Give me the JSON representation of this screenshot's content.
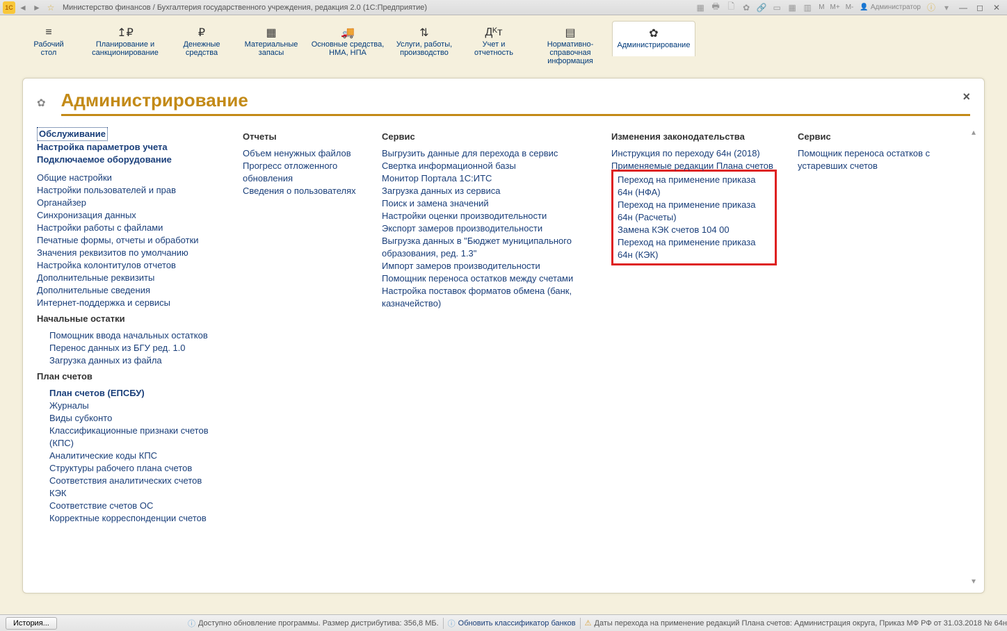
{
  "titlebar": {
    "title": "Министерство финансов / Бухгалтерия государственного учреждения, редакция 2.0  (1С:Предприятие)",
    "m_labels": [
      "M",
      "M+",
      "M-"
    ],
    "user": "Администратор"
  },
  "nav": [
    {
      "label": "Рабочий\nстол",
      "icon": "≡"
    },
    {
      "label": "Планирование и\nсанкционирование",
      "icon": "↥₽"
    },
    {
      "label": "Денежные\nсредства",
      "icon": "₽"
    },
    {
      "label": "Материальные\nзапасы",
      "icon": "▦"
    },
    {
      "label": "Основные средства,\nНМА, НПА",
      "icon": "🚚"
    },
    {
      "label": "Услуги, работы,\nпроизводство",
      "icon": "⇅"
    },
    {
      "label": "Учет и\nотчетность",
      "icon": "Дᴷт"
    },
    {
      "label": "Нормативно-справочная\nинформация",
      "icon": "▤"
    },
    {
      "label": "Администрирование",
      "icon": "✿"
    }
  ],
  "page": {
    "title": "Администрирование",
    "close": "×"
  },
  "col1": {
    "links_top": [
      {
        "text": "Обслуживание",
        "bold": true,
        "dotted": true
      },
      {
        "text": "Настройка параметров учета",
        "bold": true
      },
      {
        "text": "Подключаемое оборудование",
        "bold": true
      }
    ],
    "links_main": [
      "Общие настройки",
      "Настройки пользователей и прав",
      "Органайзер",
      "Синхронизация данных",
      "Настройки работы с файлами",
      "Печатные формы, отчеты и обработки",
      "Значения реквизитов по умолчанию",
      "Настройка колонтитулов отчетов",
      "Дополнительные реквизиты",
      "Дополнительные сведения",
      "Интернет-поддержка и сервисы"
    ],
    "sec2_head": "Начальные остатки",
    "sec2_links": [
      "Помощник ввода начальных остатков",
      "Перенос данных из БГУ ред. 1.0",
      "Загрузка данных из файла"
    ],
    "sec3_head": "План счетов",
    "sec3_links": [
      {
        "text": "План счетов (ЕПСБУ)",
        "bold": true
      },
      {
        "text": "Журналы"
      },
      {
        "text": "Виды субконто"
      },
      {
        "text": "Классификационные признаки счетов (КПС)"
      },
      {
        "text": "Аналитические коды КПС"
      },
      {
        "text": "Структуры рабочего плана счетов"
      },
      {
        "text": "Соответствия аналитических счетов"
      },
      {
        "text": "КЭК"
      },
      {
        "text": "Соответствие счетов ОС"
      },
      {
        "text": "Корректные корреспонденции счетов"
      }
    ]
  },
  "col2": {
    "head": "Отчеты",
    "links": [
      "Объем ненужных файлов",
      "Прогресс отложенного обновления",
      "Сведения о пользователях"
    ]
  },
  "col3": {
    "head": "Сервис",
    "links": [
      "Выгрузить данные для перехода в сервис",
      "Свертка информационной базы",
      "Монитор Портала 1С:ИТС",
      "Загрузка данных из сервиса",
      "Поиск и замена значений",
      "Настройки оценки производительности",
      "Экспорт замеров производительности",
      "Выгрузка данных в \"Бюджет муниципального образования, ред. 1.3\"",
      "Импорт замеров производительности",
      "Помощник переноса остатков между счетами",
      "Настройка поставок форматов обмена (банк, казначейство)"
    ]
  },
  "col4": {
    "head": "Изменения законодательства",
    "pre_links": [
      "Инструкция по переходу 64н (2018)",
      "Применяемые редакции Плана счетов"
    ],
    "box_links": [
      "Переход на применение приказа 64н (НФА)",
      "Переход на применение приказа 64н (Расчеты)",
      "Замена КЭК счетов 104 00",
      "Переход на применение приказа 64н (КЭК)"
    ]
  },
  "col5": {
    "head": "Сервис",
    "links": [
      "Помощник переноса остатков с устаревших счетов"
    ]
  },
  "status": {
    "history": "История...",
    "item1": "Доступно обновление программы. Размер дистрибутива: 356,8 МБ.",
    "item2": "Обновить классификатор банков",
    "item3": "Даты перехода на применение редакций Плана счетов: Администрация округа, Приказ МФ РФ от 31.03.2018 № 64н"
  }
}
